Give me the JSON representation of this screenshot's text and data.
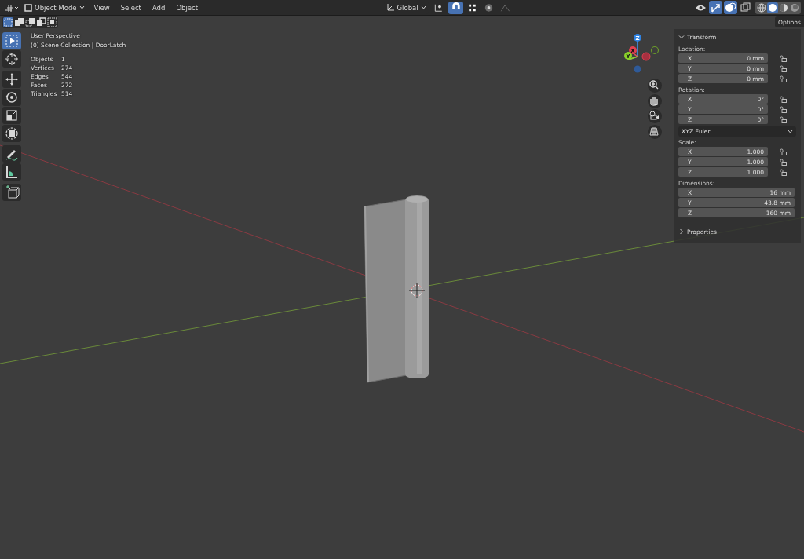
{
  "header": {
    "mode": "Object Mode",
    "menus": [
      "View",
      "Select",
      "Add",
      "Object"
    ],
    "orientation": "Global",
    "toggles": [
      {
        "kind": "pivot",
        "on": false
      },
      {
        "kind": "snap",
        "on": true
      },
      {
        "kind": "snap-target",
        "on": false
      },
      {
        "kind": "proportional",
        "on": false
      },
      {
        "kind": "falloff",
        "on": false
      }
    ],
    "view_toggles": [
      {
        "kind": "visibility",
        "on": false
      },
      {
        "kind": "gizmos",
        "on": true
      },
      {
        "kind": "overlays",
        "on": true
      },
      {
        "kind": "xray",
        "on": false
      }
    ],
    "shading": [
      {
        "kind": "wireframe",
        "selected": false
      },
      {
        "kind": "solid",
        "selected": true
      },
      {
        "kind": "material",
        "selected": false
      },
      {
        "kind": "rendered",
        "selected": false
      }
    ]
  },
  "select_modes": [
    {
      "kind": "new",
      "selected": true
    },
    {
      "kind": "extend",
      "selected": false
    },
    {
      "kind": "subtract",
      "selected": false
    },
    {
      "kind": "invert",
      "selected": false
    },
    {
      "kind": "intersect",
      "selected": false
    }
  ],
  "options_button": "Options",
  "toolbar": [
    {
      "tools": [
        {
          "kind": "select",
          "selected": true
        },
        {
          "kind": "cursor",
          "selected": false
        }
      ]
    },
    {
      "tools": [
        {
          "kind": "move",
          "selected": false
        },
        {
          "kind": "rotate",
          "selected": false
        },
        {
          "kind": "scale",
          "selected": false
        },
        {
          "kind": "transform",
          "selected": false
        }
      ]
    },
    {
      "tools": [
        {
          "kind": "annotate",
          "selected": false
        },
        {
          "kind": "measure",
          "selected": false
        }
      ]
    },
    {
      "tools": [
        {
          "kind": "add-cube",
          "selected": false
        }
      ]
    }
  ],
  "viewport_info": {
    "view": "User Perspective",
    "collection": "(0) Scene Collection | DoorLatch"
  },
  "stats": [
    {
      "label": "Objects",
      "value": "1"
    },
    {
      "label": "Vertices",
      "value": "274"
    },
    {
      "label": "Edges",
      "value": "544"
    },
    {
      "label": "Faces",
      "value": "272"
    },
    {
      "label": "Triangles",
      "value": "514"
    }
  ],
  "gizmo": {
    "z": "Z",
    "x": "X",
    "y": "Y"
  },
  "sidebar": {
    "title": "Transform",
    "expanded": true,
    "groups": [
      {
        "label": "Location:",
        "lockable": true,
        "fields": [
          {
            "axis": "X",
            "value": "0 mm"
          },
          {
            "axis": "Y",
            "value": "0 mm"
          },
          {
            "axis": "Z",
            "value": "0 mm"
          }
        ]
      },
      {
        "label": "Rotation:",
        "lockable": true,
        "fields": [
          {
            "axis": "X",
            "value": "0°"
          },
          {
            "axis": "Y",
            "value": "0°"
          },
          {
            "axis": "Z",
            "value": "0°"
          }
        ],
        "mode": "XYZ Euler"
      },
      {
        "label": "Scale:",
        "lockable": true,
        "fields": [
          {
            "axis": "X",
            "value": "1.000"
          },
          {
            "axis": "Y",
            "value": "1.000"
          },
          {
            "axis": "Z",
            "value": "1.000"
          }
        ]
      },
      {
        "label": "Dimensions:",
        "lockable": false,
        "fields": [
          {
            "axis": "X",
            "value": "16 mm"
          },
          {
            "axis": "Y",
            "value": "43.8 mm"
          },
          {
            "axis": "Z",
            "value": "160 mm"
          }
        ]
      }
    ],
    "properties": {
      "title": "Properties",
      "expanded": false
    }
  }
}
